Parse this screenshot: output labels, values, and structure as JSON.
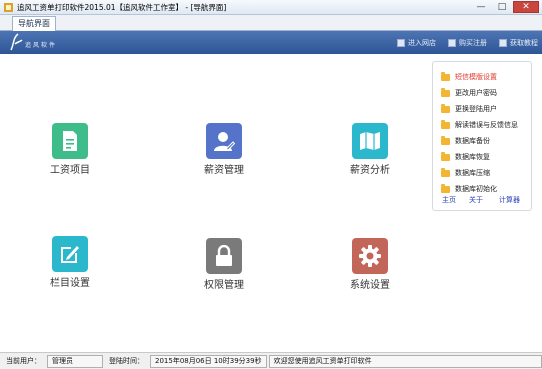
{
  "window": {
    "title": "追风工资单打印软件2015.01【追风软件工作室】 - [导航界面]",
    "minimize": "—",
    "maximize": "□",
    "close": "✕"
  },
  "tabs": [
    {
      "label": "导航界面"
    }
  ],
  "banner": {
    "brand": "追风软件",
    "links": [
      {
        "label": "进入网店",
        "icon": "shop-icon"
      },
      {
        "label": "购买注册",
        "icon": "register-icon"
      },
      {
        "label": "获取教程",
        "icon": "tutorial-icon"
      }
    ]
  },
  "modules": [
    {
      "label": "工资项目",
      "icon": "document-icon",
      "color": "#3ebd8a"
    },
    {
      "label": "薪资管理",
      "icon": "user-edit-icon",
      "color": "#5473c9"
    },
    {
      "label": "薪资分析",
      "icon": "map-icon",
      "color": "#2bb8cc"
    },
    {
      "label": "栏目设置",
      "icon": "edit-icon",
      "color": "#2bb8cc"
    },
    {
      "label": "权限管理",
      "icon": "lock-icon",
      "color": "#7a7a7a"
    },
    {
      "label": "系统设置",
      "icon": "gear-icon",
      "color": "#c2665a"
    }
  ],
  "quick_panel": {
    "items": [
      {
        "label": "短信模版设置"
      },
      {
        "label": "更改用户密码"
      },
      {
        "label": "更换登陆用户"
      },
      {
        "label": "解读错误与反馈信息"
      },
      {
        "label": "数据库备份"
      },
      {
        "label": "数据库恢复"
      },
      {
        "label": "数据库压缩"
      },
      {
        "label": "数据库初始化"
      }
    ],
    "footer": [
      "主页",
      "关于",
      "计算器"
    ]
  },
  "status": {
    "user_label": "当前用户：",
    "user_value": "管理员",
    "login_label": "登陆时间：",
    "login_value": "2015年08月06日 10时39分39秒",
    "welcome": "欢迎您使用追风工资单打印软件"
  },
  "colors": {
    "banner": "#3a63a6",
    "accent_red": "#e03a2c",
    "link_blue": "#2a44b8",
    "folder": "#f3b632"
  }
}
